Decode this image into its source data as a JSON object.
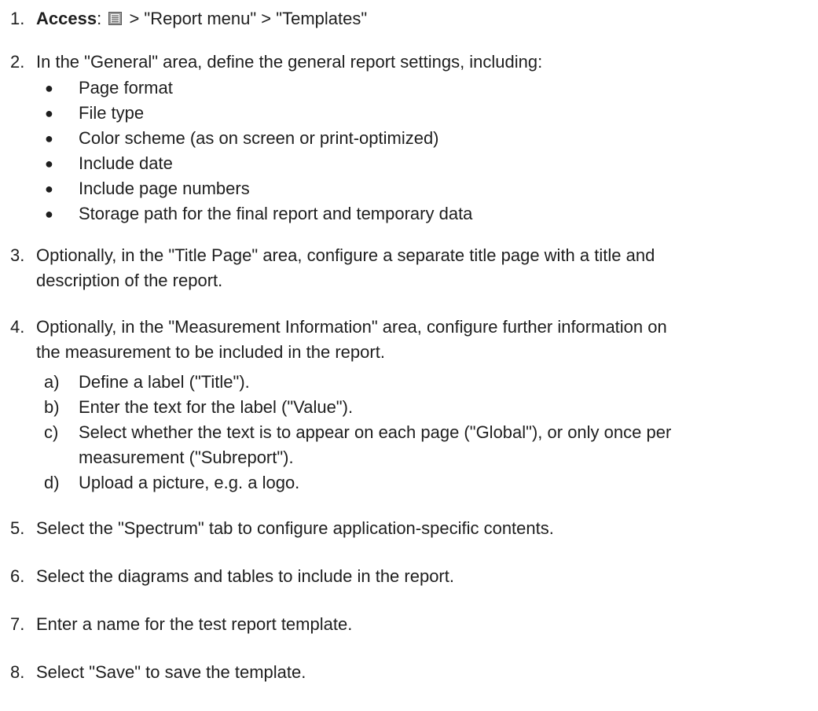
{
  "steps": [
    {
      "number": "1.",
      "access_label": "Access",
      "access_colon": ":",
      "access_path": " > \"Report menu\" > \"Templates\""
    },
    {
      "number": "2.",
      "text": "In the \"General\" area, define the general report settings, including:",
      "bullets": [
        "Page format",
        "File type",
        "Color scheme (as on screen or print-optimized)",
        "Include date",
        "Include page numbers",
        "Storage path for the final report and temporary data"
      ]
    },
    {
      "number": "3.",
      "text_line1": "Optionally, in the \"Title Page\" area, configure a separate title page with a title and",
      "text_line2": "description of the report."
    },
    {
      "number": "4.",
      "text_line1": "Optionally, in the \"Measurement Information\" area, configure further information on",
      "text_line2": "the measurement to be included in the report.",
      "substeps": [
        {
          "letter": "a)",
          "text": "Define a label (\"Title\")."
        },
        {
          "letter": "b)",
          "text": "Enter the text for the label (\"Value\")."
        },
        {
          "letter": "c)",
          "text_line1": "Select whether the text is to appear on each page (\"Global\"), or only once per",
          "text_line2": "measurement (\"Subreport\")."
        },
        {
          "letter": "d)",
          "text": "Upload a picture, e.g. a logo."
        }
      ]
    },
    {
      "number": "5.",
      "text": "Select the \"Spectrum\" tab to configure application-specific contents."
    },
    {
      "number": "6.",
      "text": "Select the diagrams and tables to include in the report."
    },
    {
      "number": "7.",
      "text": "Enter a name for the test report template."
    },
    {
      "number": "8.",
      "text": "Select \"Save\" to save the template."
    }
  ],
  "icons": {
    "menu_icon": "report-menu-icon"
  }
}
